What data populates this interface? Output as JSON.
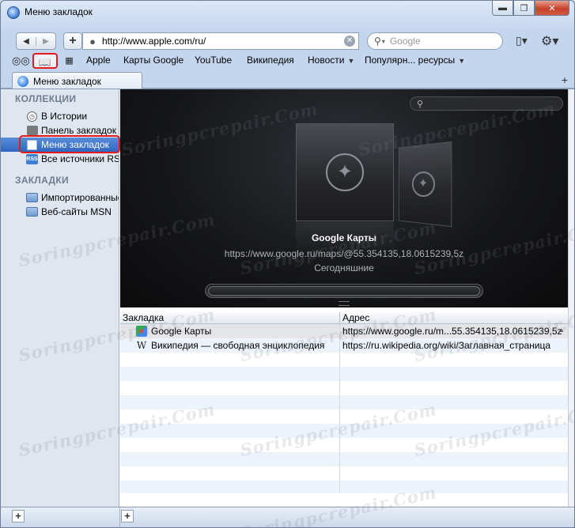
{
  "window": {
    "title": "Меню закладок",
    "minimize": "▬",
    "maximize": "❐",
    "close": "✕"
  },
  "toolbar": {
    "back": "◀",
    "forward": "▶",
    "add": "+",
    "url": "http://www.apple.com/ru/",
    "search_placeholder": "Google",
    "reload": "↻",
    "stop": "✕"
  },
  "bookmarks_bar": {
    "items": [
      {
        "label": "Apple",
        "menu": false
      },
      {
        "label": "Карты Google",
        "menu": false
      },
      {
        "label": "YouTube",
        "menu": false
      },
      {
        "label": "Википедия",
        "menu": false
      },
      {
        "label": "Новости",
        "menu": true
      },
      {
        "label": "Популярн... ресурсы",
        "menu": true
      }
    ]
  },
  "tab": {
    "label": "Меню закладок",
    "add": "+"
  },
  "sidebar": {
    "collections_heading": "КОЛЛЕКЦИИ",
    "collections": [
      {
        "label": "В Истории",
        "icon": "clock-icon"
      },
      {
        "label": "Панель закладок",
        "icon": "bookmarks-bar-icon"
      },
      {
        "label": "Меню закладок",
        "icon": "bookmarks-menu-icon",
        "selected": true
      },
      {
        "label": "Все источники RSS",
        "icon": "rss-icon"
      }
    ],
    "bookmarks_heading": "ЗАКЛАДКИ",
    "bookmarks": [
      {
        "label": "Импортированные",
        "icon": "folder-icon"
      },
      {
        "label": "Веб-сайты MSN",
        "icon": "folder-icon"
      }
    ],
    "add_label": "+"
  },
  "coverflow": {
    "title": "Google Карты",
    "url": "https://www.google.ru/maps/@55.354135,18.0615239,5z",
    "date": "Сегодняшние"
  },
  "table": {
    "headers": [
      "Закладка",
      "Адрес"
    ],
    "rows": [
      {
        "name": "Google Карты",
        "address": "https://www.google.ru/m...55.354135,18.0615239,5z",
        "icon": "google-maps-icon"
      },
      {
        "name": "Википедия — свободная энциклопедия",
        "address": "https://ru.wikipedia.org/wiki/Заглавная_страница",
        "icon": "wikipedia-icon"
      }
    ],
    "add_label": "+"
  },
  "watermark": "Soringpcrepair.Com",
  "colors": {
    "highlight": "#e31b1b",
    "selection": "#3a72c8",
    "coverflow_bg": "#16171a"
  }
}
